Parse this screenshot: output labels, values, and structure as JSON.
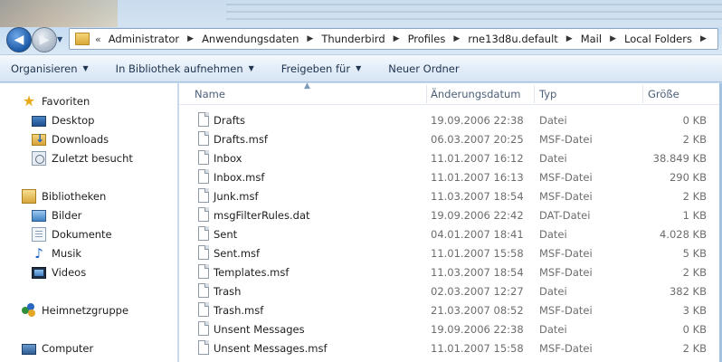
{
  "window": {
    "breadcrumb": [
      "Administrator",
      "Anwendungsdaten",
      "Thunderbird",
      "Profiles",
      "rne13d8u.default",
      "Mail",
      "Local Folders"
    ],
    "overflow_chevrons": "«"
  },
  "toolbar": {
    "organize": "Organisieren",
    "include_library": "In Bibliothek aufnehmen",
    "share_with": "Freigeben für",
    "new_folder": "Neuer Ordner"
  },
  "navpane": {
    "favorites": "Favoriten",
    "desktop": "Desktop",
    "downloads": "Downloads",
    "recent": "Zuletzt besucht",
    "libraries": "Bibliotheken",
    "pictures": "Bilder",
    "documents": "Dokumente",
    "music": "Musik",
    "videos": "Videos",
    "homegroup": "Heimnetzgruppe",
    "computer": "Computer"
  },
  "columns": {
    "name": "Name",
    "modified": "Änderungsdatum",
    "type": "Typ",
    "size": "Größe"
  },
  "files": [
    {
      "name": "Drafts",
      "date": "19.09.2006 22:38",
      "type": "Datei",
      "size": "0 KB"
    },
    {
      "name": "Drafts.msf",
      "date": "06.03.2007 20:25",
      "type": "MSF-Datei",
      "size": "2 KB"
    },
    {
      "name": "Inbox",
      "date": "11.01.2007 16:12",
      "type": "Datei",
      "size": "38.849 KB"
    },
    {
      "name": "Inbox.msf",
      "date": "11.01.2007 16:13",
      "type": "MSF-Datei",
      "size": "290 KB"
    },
    {
      "name": "Junk.msf",
      "date": "11.03.2007 18:54",
      "type": "MSF-Datei",
      "size": "2 KB"
    },
    {
      "name": "msgFilterRules.dat",
      "date": "19.09.2006 22:42",
      "type": "DAT-Datei",
      "size": "1 KB"
    },
    {
      "name": "Sent",
      "date": "04.01.2007 18:41",
      "type": "Datei",
      "size": "4.028 KB"
    },
    {
      "name": "Sent.msf",
      "date": "11.01.2007 15:58",
      "type": "MSF-Datei",
      "size": "5 KB"
    },
    {
      "name": "Templates.msf",
      "date": "11.03.2007 18:54",
      "type": "MSF-Datei",
      "size": "2 KB"
    },
    {
      "name": "Trash",
      "date": "02.03.2007 12:27",
      "type": "Datei",
      "size": "382 KB"
    },
    {
      "name": "Trash.msf",
      "date": "21.03.2007 08:52",
      "type": "MSF-Datei",
      "size": "3 KB"
    },
    {
      "name": "Unsent Messages",
      "date": "19.09.2006 22:38",
      "type": "Datei",
      "size": "0 KB"
    },
    {
      "name": "Unsent Messages.msf",
      "date": "11.01.2007 15:58",
      "type": "MSF-Datei",
      "size": "2 KB"
    }
  ]
}
